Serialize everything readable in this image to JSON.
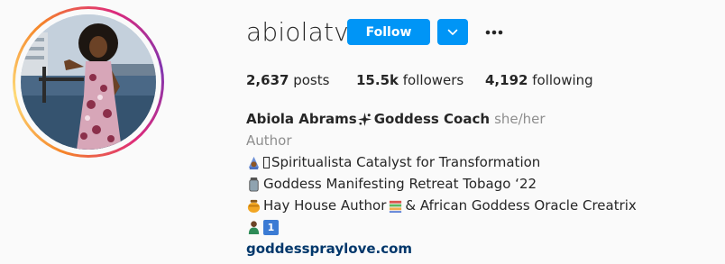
{
  "profile": {
    "username": "abiolatv",
    "follow_label": "Follow",
    "stats": {
      "posts_count": "2,637",
      "posts_label": "posts",
      "followers_count": "15.5k",
      "followers_label": "followers",
      "following_count": "4,192",
      "following_label": "following"
    },
    "bio": {
      "name_part1": "Abiola Abrams",
      "name_part2": "Goddess Coach",
      "pronouns": "she/her",
      "category": "Author",
      "line1": "Spiritualista Catalyst for Transformation",
      "line2": "Goddess Manifesting Retreat Tobago ‘22",
      "line3_part1": "Hay House Author",
      "line3_part2": "& African Goddess Oracle Creatrix",
      "line4_badge": "1",
      "website": "goddesspraylove.com"
    }
  },
  "colors": {
    "primary_button": "#0095f6",
    "text": "#262626",
    "muted": "#8e8e8e",
    "link": "#00376b"
  },
  "icons": {
    "dropdown": "chevron-down-icon",
    "more": "more-horizontal-icon"
  }
}
